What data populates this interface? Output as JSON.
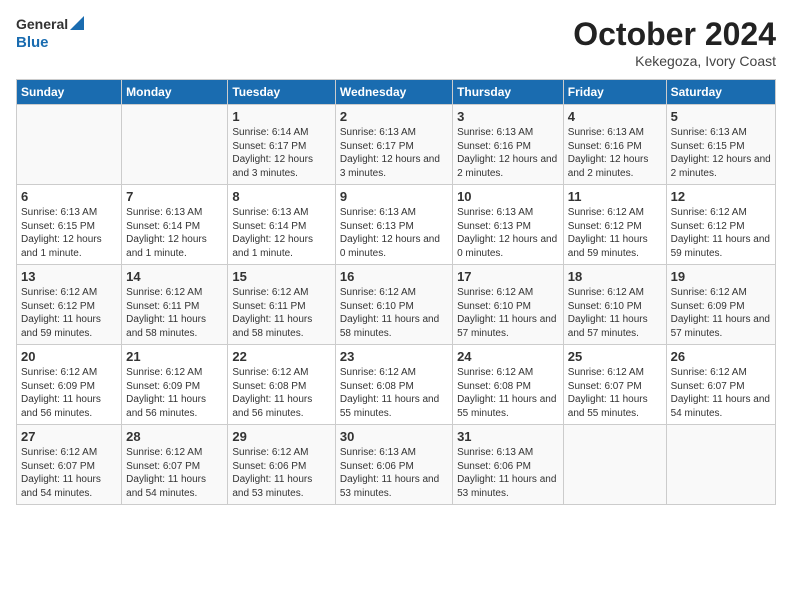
{
  "header": {
    "logo": {
      "general": "General",
      "blue": "Blue"
    },
    "title": "October 2024",
    "subtitle": "Kekegoza, Ivory Coast"
  },
  "days_of_week": [
    "Sunday",
    "Monday",
    "Tuesday",
    "Wednesday",
    "Thursday",
    "Friday",
    "Saturday"
  ],
  "weeks": [
    [
      {
        "day": "",
        "sunrise": "",
        "sunset": "",
        "daylight": ""
      },
      {
        "day": "",
        "sunrise": "",
        "sunset": "",
        "daylight": ""
      },
      {
        "day": "1",
        "sunrise": "Sunrise: 6:14 AM",
        "sunset": "Sunset: 6:17 PM",
        "daylight": "Daylight: 12 hours and 3 minutes."
      },
      {
        "day": "2",
        "sunrise": "Sunrise: 6:13 AM",
        "sunset": "Sunset: 6:17 PM",
        "daylight": "Daylight: 12 hours and 3 minutes."
      },
      {
        "day": "3",
        "sunrise": "Sunrise: 6:13 AM",
        "sunset": "Sunset: 6:16 PM",
        "daylight": "Daylight: 12 hours and 2 minutes."
      },
      {
        "day": "4",
        "sunrise": "Sunrise: 6:13 AM",
        "sunset": "Sunset: 6:16 PM",
        "daylight": "Daylight: 12 hours and 2 minutes."
      },
      {
        "day": "5",
        "sunrise": "Sunrise: 6:13 AM",
        "sunset": "Sunset: 6:15 PM",
        "daylight": "Daylight: 12 hours and 2 minutes."
      }
    ],
    [
      {
        "day": "6",
        "sunrise": "Sunrise: 6:13 AM",
        "sunset": "Sunset: 6:15 PM",
        "daylight": "Daylight: 12 hours and 1 minute."
      },
      {
        "day": "7",
        "sunrise": "Sunrise: 6:13 AM",
        "sunset": "Sunset: 6:14 PM",
        "daylight": "Daylight: 12 hours and 1 minute."
      },
      {
        "day": "8",
        "sunrise": "Sunrise: 6:13 AM",
        "sunset": "Sunset: 6:14 PM",
        "daylight": "Daylight: 12 hours and 1 minute."
      },
      {
        "day": "9",
        "sunrise": "Sunrise: 6:13 AM",
        "sunset": "Sunset: 6:13 PM",
        "daylight": "Daylight: 12 hours and 0 minutes."
      },
      {
        "day": "10",
        "sunrise": "Sunrise: 6:13 AM",
        "sunset": "Sunset: 6:13 PM",
        "daylight": "Daylight: 12 hours and 0 minutes."
      },
      {
        "day": "11",
        "sunrise": "Sunrise: 6:12 AM",
        "sunset": "Sunset: 6:12 PM",
        "daylight": "Daylight: 11 hours and 59 minutes."
      },
      {
        "day": "12",
        "sunrise": "Sunrise: 6:12 AM",
        "sunset": "Sunset: 6:12 PM",
        "daylight": "Daylight: 11 hours and 59 minutes."
      }
    ],
    [
      {
        "day": "13",
        "sunrise": "Sunrise: 6:12 AM",
        "sunset": "Sunset: 6:12 PM",
        "daylight": "Daylight: 11 hours and 59 minutes."
      },
      {
        "day": "14",
        "sunrise": "Sunrise: 6:12 AM",
        "sunset": "Sunset: 6:11 PM",
        "daylight": "Daylight: 11 hours and 58 minutes."
      },
      {
        "day": "15",
        "sunrise": "Sunrise: 6:12 AM",
        "sunset": "Sunset: 6:11 PM",
        "daylight": "Daylight: 11 hours and 58 minutes."
      },
      {
        "day": "16",
        "sunrise": "Sunrise: 6:12 AM",
        "sunset": "Sunset: 6:10 PM",
        "daylight": "Daylight: 11 hours and 58 minutes."
      },
      {
        "day": "17",
        "sunrise": "Sunrise: 6:12 AM",
        "sunset": "Sunset: 6:10 PM",
        "daylight": "Daylight: 11 hours and 57 minutes."
      },
      {
        "day": "18",
        "sunrise": "Sunrise: 6:12 AM",
        "sunset": "Sunset: 6:10 PM",
        "daylight": "Daylight: 11 hours and 57 minutes."
      },
      {
        "day": "19",
        "sunrise": "Sunrise: 6:12 AM",
        "sunset": "Sunset: 6:09 PM",
        "daylight": "Daylight: 11 hours and 57 minutes."
      }
    ],
    [
      {
        "day": "20",
        "sunrise": "Sunrise: 6:12 AM",
        "sunset": "Sunset: 6:09 PM",
        "daylight": "Daylight: 11 hours and 56 minutes."
      },
      {
        "day": "21",
        "sunrise": "Sunrise: 6:12 AM",
        "sunset": "Sunset: 6:09 PM",
        "daylight": "Daylight: 11 hours and 56 minutes."
      },
      {
        "day": "22",
        "sunrise": "Sunrise: 6:12 AM",
        "sunset": "Sunset: 6:08 PM",
        "daylight": "Daylight: 11 hours and 56 minutes."
      },
      {
        "day": "23",
        "sunrise": "Sunrise: 6:12 AM",
        "sunset": "Sunset: 6:08 PM",
        "daylight": "Daylight: 11 hours and 55 minutes."
      },
      {
        "day": "24",
        "sunrise": "Sunrise: 6:12 AM",
        "sunset": "Sunset: 6:08 PM",
        "daylight": "Daylight: 11 hours and 55 minutes."
      },
      {
        "day": "25",
        "sunrise": "Sunrise: 6:12 AM",
        "sunset": "Sunset: 6:07 PM",
        "daylight": "Daylight: 11 hours and 55 minutes."
      },
      {
        "day": "26",
        "sunrise": "Sunrise: 6:12 AM",
        "sunset": "Sunset: 6:07 PM",
        "daylight": "Daylight: 11 hours and 54 minutes."
      }
    ],
    [
      {
        "day": "27",
        "sunrise": "Sunrise: 6:12 AM",
        "sunset": "Sunset: 6:07 PM",
        "daylight": "Daylight: 11 hours and 54 minutes."
      },
      {
        "day": "28",
        "sunrise": "Sunrise: 6:12 AM",
        "sunset": "Sunset: 6:07 PM",
        "daylight": "Daylight: 11 hours and 54 minutes."
      },
      {
        "day": "29",
        "sunrise": "Sunrise: 6:12 AM",
        "sunset": "Sunset: 6:06 PM",
        "daylight": "Daylight: 11 hours and 53 minutes."
      },
      {
        "day": "30",
        "sunrise": "Sunrise: 6:13 AM",
        "sunset": "Sunset: 6:06 PM",
        "daylight": "Daylight: 11 hours and 53 minutes."
      },
      {
        "day": "31",
        "sunrise": "Sunrise: 6:13 AM",
        "sunset": "Sunset: 6:06 PM",
        "daylight": "Daylight: 11 hours and 53 minutes."
      },
      {
        "day": "",
        "sunrise": "",
        "sunset": "",
        "daylight": ""
      },
      {
        "day": "",
        "sunrise": "",
        "sunset": "",
        "daylight": ""
      }
    ]
  ]
}
